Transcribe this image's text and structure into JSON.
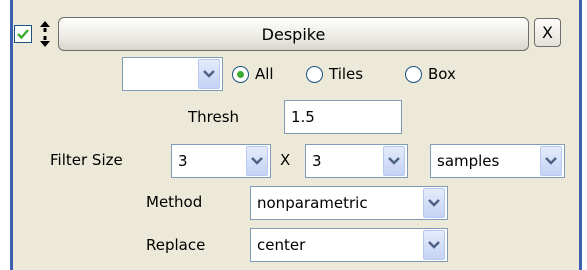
{
  "filter": {
    "title": "Despike",
    "close_label": "X",
    "enabled": true
  },
  "region": {
    "dropdown_value": "",
    "options": [
      {
        "label": "All",
        "selected": true
      },
      {
        "label": "Tiles",
        "selected": false
      },
      {
        "label": "Box",
        "selected": false
      }
    ]
  },
  "thresh": {
    "label": "Thresh",
    "value": "1.5"
  },
  "filter_size": {
    "label": "Filter Size",
    "x_value": "3",
    "separator": "X",
    "y_value": "3",
    "units": "samples"
  },
  "method": {
    "label": "Method",
    "value": "nonparametric"
  },
  "replace": {
    "label": "Replace",
    "value": "center"
  },
  "colors": {
    "panel_bg": "#ece9d8",
    "frame_blue": "#3b5fae",
    "check_green": "#3dab2e",
    "combo_border": "#7f9db9"
  }
}
